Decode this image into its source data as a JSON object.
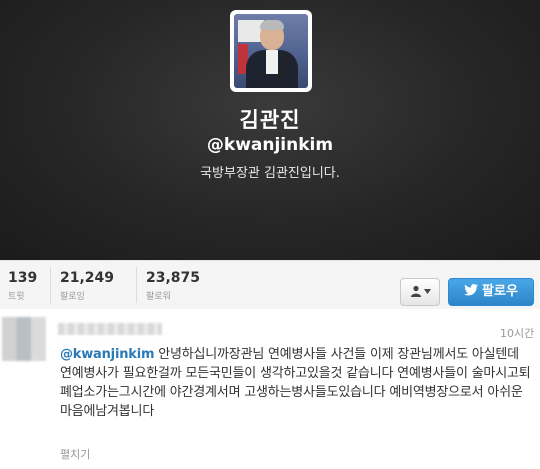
{
  "profile": {
    "name": "김관진",
    "handle": "@kwanjinkim",
    "bio": "국방부장관 김관진입니다."
  },
  "stats": [
    {
      "value": "139",
      "label": "트윗"
    },
    {
      "value": "21,249",
      "label": "팔로잉"
    },
    {
      "value": "23,875",
      "label": "팔로워"
    }
  ],
  "actions": {
    "user_menu_label": "👤▾",
    "follow_label": "팔로우"
  },
  "tweet": {
    "time": "10시간",
    "mention": "@kwanjinkim",
    "body": " 안녕하십니까장관님 연예병사들 사건들 이제 장관님께서도 아실텐데 연예병사가 필요한걸까 모든국민들이 생각하고있을것 같습니다 연예병사들이 술마시고퇴폐업소가는그시간에 야간경계서며 고생하는병사들도있습니다 예비역병장으로서 아쉬운마음에남겨봅니다",
    "expand_label": "펼치기"
  },
  "colors": {
    "header_bg": "#262626",
    "follow_button": "#2d85c8",
    "mention": "#2a7ab8"
  }
}
